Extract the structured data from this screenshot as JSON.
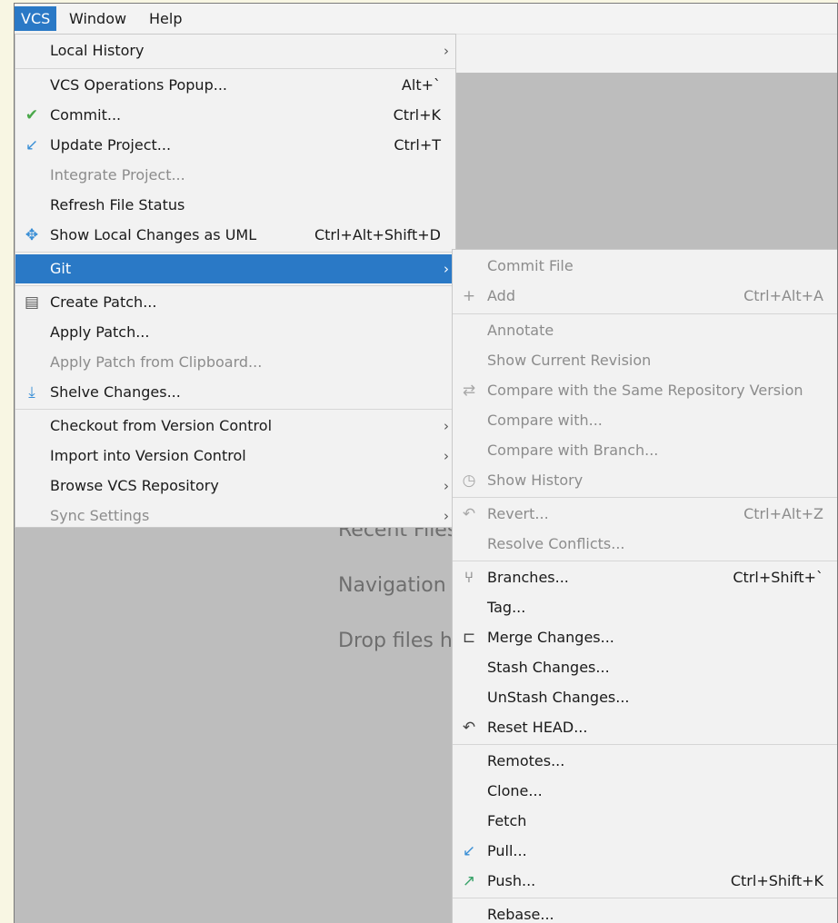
{
  "menubar": {
    "items": [
      "VCS",
      "Window",
      "Help"
    ]
  },
  "welcome": {
    "recent_files": "Recent Files",
    "navigation": "Navigation",
    "drop_files": "Drop files h"
  },
  "vcs_menu": {
    "local_history": "Local History",
    "vcs_operations_popup": {
      "label": "VCS Operations Popup...",
      "shortcut": "Alt+`"
    },
    "commit": {
      "label": "Commit...",
      "shortcut": "Ctrl+K"
    },
    "update_project": {
      "label": "Update Project...",
      "shortcut": "Ctrl+T"
    },
    "integrate_project": "Integrate Project...",
    "refresh_file_status": "Refresh File Status",
    "show_local_changes_uml": {
      "label": "Show Local Changes as UML",
      "shortcut": "Ctrl+Alt+Shift+D"
    },
    "git": "Git",
    "create_patch": "Create Patch...",
    "apply_patch": "Apply Patch...",
    "apply_patch_clipboard": "Apply Patch from Clipboard...",
    "shelve_changes": "Shelve Changes...",
    "checkout_vc": "Checkout from Version Control",
    "import_vc": "Import into Version Control",
    "browse_vcs_repo": "Browse VCS Repository",
    "sync_settings": "Sync Settings"
  },
  "git_menu": {
    "commit_file": "Commit File",
    "add": {
      "label": "Add",
      "shortcut": "Ctrl+Alt+A"
    },
    "annotate": "Annotate",
    "show_current_revision": "Show Current Revision",
    "compare_same_repo": "Compare with the Same Repository Version",
    "compare_with": "Compare with...",
    "compare_with_branch": "Compare with Branch...",
    "show_history": "Show History",
    "revert": {
      "label": "Revert...",
      "shortcut": "Ctrl+Alt+Z"
    },
    "resolve_conflicts": "Resolve Conflicts...",
    "branches": {
      "label": "Branches...",
      "shortcut": "Ctrl+Shift+`"
    },
    "tag": "Tag...",
    "merge_changes": "Merge Changes...",
    "stash_changes": "Stash Changes...",
    "unstash_changes": "UnStash Changes...",
    "reset_head": "Reset HEAD...",
    "remotes": "Remotes...",
    "clone": "Clone...",
    "fetch": "Fetch",
    "pull": "Pull...",
    "push": {
      "label": "Push...",
      "shortcut": "Ctrl+Shift+K"
    },
    "rebase": "Rebase..."
  },
  "icons": {
    "commit": "check-icon",
    "update_project": "update-arrow-icon",
    "show_local_changes_uml": "uml-diagram-icon",
    "create_patch": "patch-icon",
    "shelve_changes": "shelve-icon",
    "add": "plus-icon",
    "compare_same_repo": "compare-icon",
    "show_history": "history-clock-icon",
    "revert": "revert-icon",
    "branches": "branch-icon",
    "merge_changes": "merge-icon",
    "reset_head": "undo-icon",
    "pull": "pull-arrow-icon",
    "push": "push-arrow-icon"
  },
  "colors": {
    "selection": "#2a79c6",
    "disabled_text": "#8c8c8c",
    "menu_bg": "#f2f2f2"
  }
}
